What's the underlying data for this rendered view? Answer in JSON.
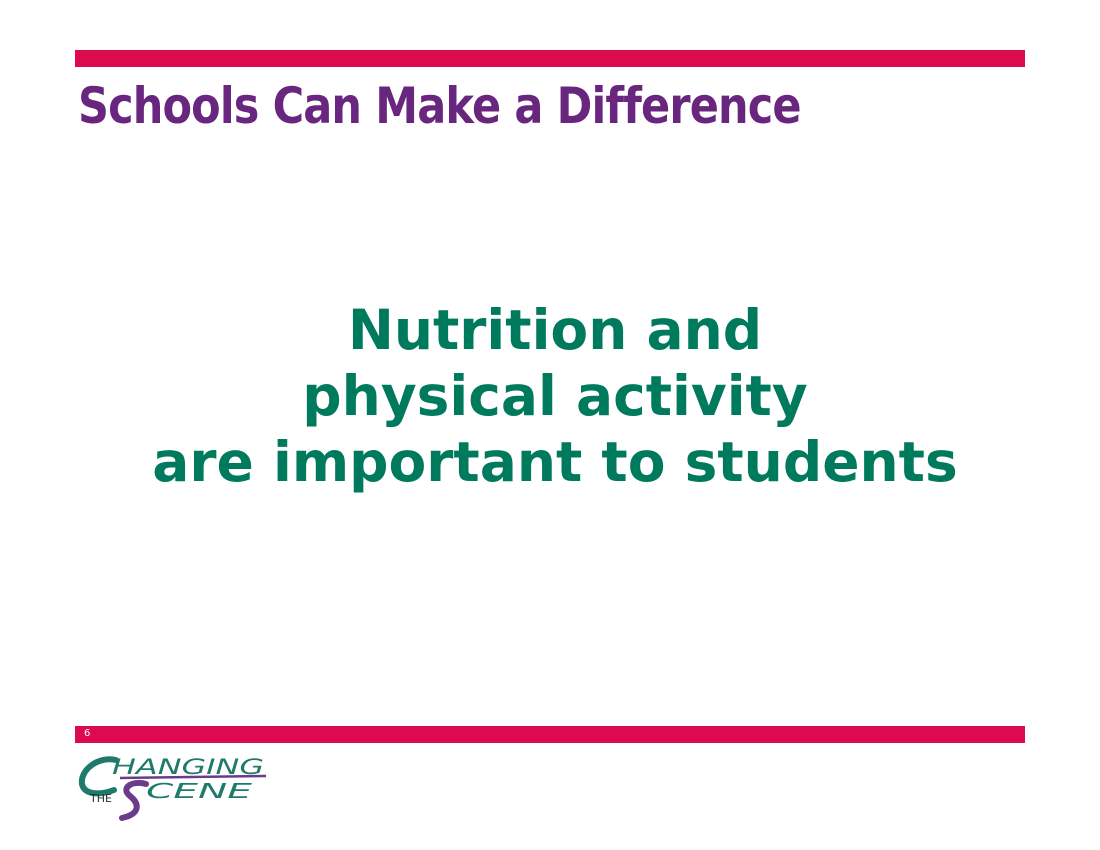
{
  "slide": {
    "title": "Schools Can Make a Difference",
    "body_lines": [
      "Nutrition and",
      "physical activity",
      "are important to students"
    ],
    "page_number": "6"
  },
  "logo": {
    "word_top": "HANGING",
    "word_the": "THE",
    "word_bottom": "CENE"
  },
  "colors": {
    "accent_bar": "#dc0a4f",
    "title": "#69267f",
    "body": "#007a5c",
    "logo_teal": "#1f7a6a",
    "logo_purple": "#6a3b8a"
  }
}
